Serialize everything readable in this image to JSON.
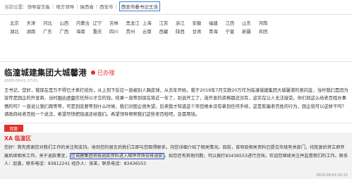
{
  "breadcrumb": {
    "prefix": "当前位置：",
    "items": [
      "领导留言板",
      "地方领导",
      "陕西省",
      "西安市"
    ],
    "current": "西安市委书记王浩"
  },
  "regions": [
    [
      "北京",
      "天津",
      "河北",
      "山西",
      "内蒙古",
      "辽宁",
      "吉林",
      "黑龙江",
      "上海",
      "江苏",
      "浙江",
      "安徽",
      "福建",
      "江西",
      "山东",
      "河南"
    ],
    [
      "湖北",
      "湖南",
      "广东",
      "广西",
      "海南",
      "重庆",
      "四川",
      "贵州",
      "云南",
      "西藏",
      "陕西",
      "甘肃",
      "青海",
      "宁夏",
      "新疆",
      "兵团"
    ]
  ],
  "post": {
    "title": "临潼城建集团大城馨港",
    "status": "已办理",
    "time": "2020-09-01 17:01",
    "body_before": "王书记，您好，我现在是万不得已才来打扰你，从上到下反应一直被别人踢皮球，从去年开始，我于2019年7月交款20万作为临潼城建集团大城馨港的意向金，当时我们是因为宣传是国企的开发商，当时",
    "body_highlight": "别人才会",
    "body_after": "信任所以才交的钱，结果一直等到现在将近一年了，别说开工了，连开发的资格都还没有，这实在让人无法接受。你们就这么给老百姓办事情的吗？一直说让我们再等等，可是到底要等到什么时候，我们对国企很失望。后来我才知道这个项目根本没有拿到任何手续，这是欺骗老百姓的行为，国企就可以这样干吗？请政府给老百姓一个说法，希望尽快把钱退还给我们。希望领导帮帮我们这些老百姓吧，急需用钱。"
  },
  "reply": {
    "tag": "回复",
    "org": "XA 临潼区",
    "text_before": "您好！首先感谢您对我们工作的关注和支持。收到您的留言后我们立即与您取得联系，向您详细介绍了相关情况。目前，该项目相关资料已提交市级有关部门，待批复后将立即开展后续相关工作。关于退款事宜，",
    "text_boxed": "区城建集团将按退款资料进入顺序尽快安排退款",
    "text_after": "，如您还有其他问题，可以拨打83436553进行咨询。欢迎您继续关注并监督我们的工作。联系人：赵鑫，联系电话：83812241 经办人：张某，联系电话：83436553",
    "date": "2020-09-03 20:22"
  }
}
